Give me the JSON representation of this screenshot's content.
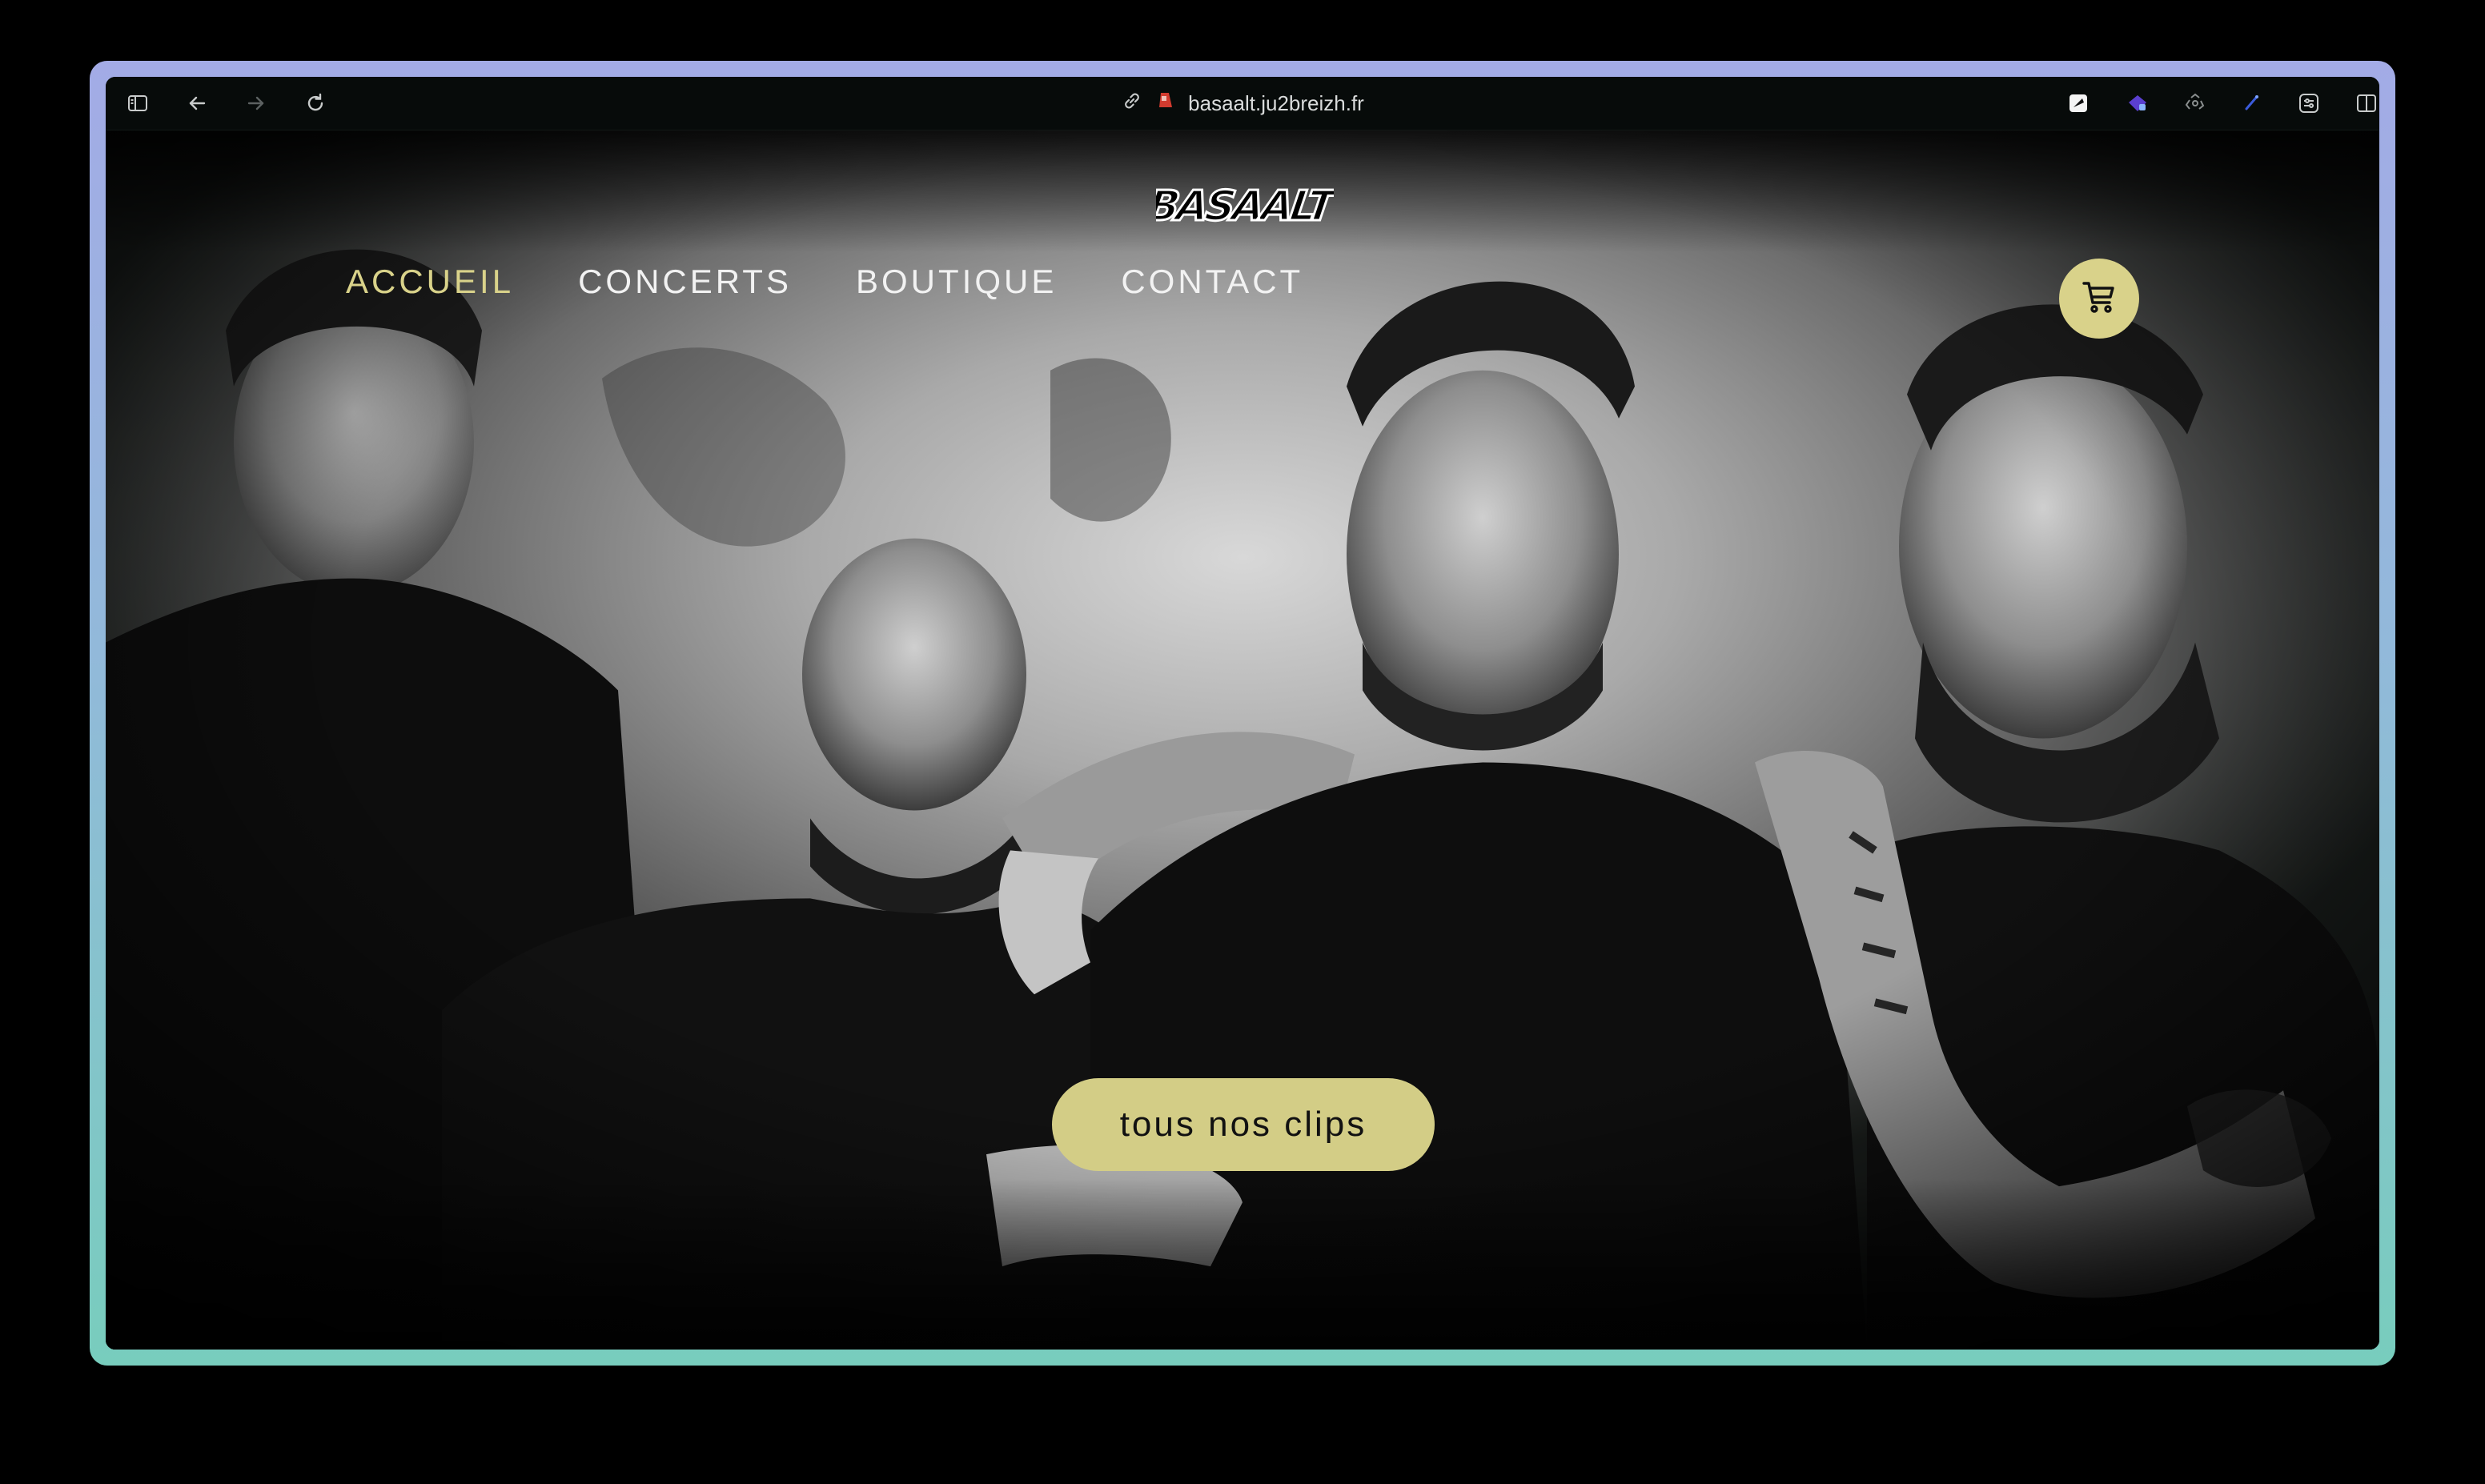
{
  "browser": {
    "url": "basaalt.ju2breizh.fr",
    "icons": [
      "sidebar-icon",
      "back-icon",
      "forward-icon",
      "reload-icon",
      "link-icon",
      "site-favicon",
      "extension-icon",
      "extension-icon",
      "extension-icon",
      "extension-icon",
      "extension-icon",
      "split-view-icon"
    ]
  },
  "site": {
    "logo_text": "BASAALT",
    "nav": [
      {
        "label": "ACCUEIL",
        "active": true
      },
      {
        "label": "CONCERTS",
        "active": false
      },
      {
        "label": "BOUTIQUE",
        "active": false
      },
      {
        "label": "CONTACT",
        "active": false
      }
    ],
    "cart_icon": "cart-icon",
    "cta_label": "tous nos clips",
    "accent_color": "#d9d28a"
  }
}
